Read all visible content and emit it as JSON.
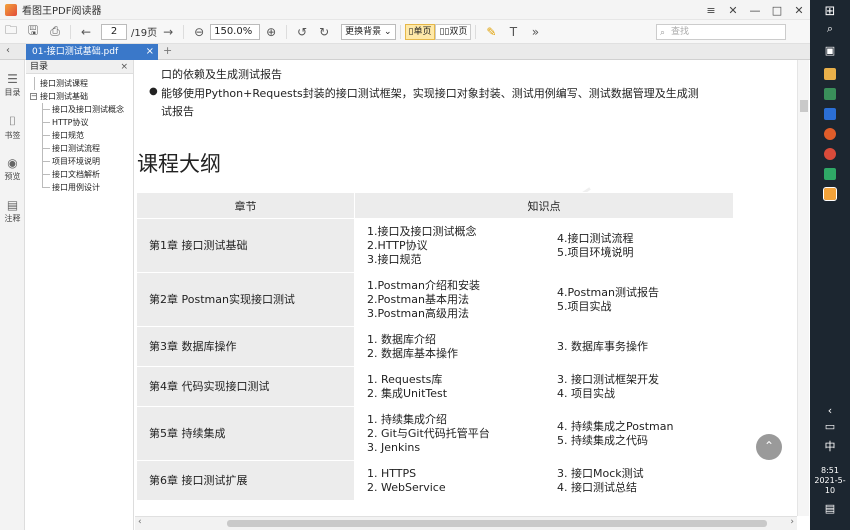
{
  "window": {
    "title": "看图王PDF阅读器",
    "controls": [
      "≡",
      "✕",
      "—",
      "□",
      "✕"
    ]
  },
  "toolbar": {
    "page_current": "2",
    "page_total": "/19页",
    "zoom": "150.0%",
    "background_label": "更换背景",
    "view_single": "单页",
    "view_double": "双页",
    "search_placeholder": "查找"
  },
  "tabbar": {
    "tab_label": "01-接口测试基础.pdf",
    "close": "×",
    "add": "+"
  },
  "leftbar": {
    "items": [
      {
        "label": "目录",
        "icon": "toc-icon"
      },
      {
        "label": "书签",
        "icon": "bookmark-icon"
      },
      {
        "label": "预览",
        "icon": "preview-icon"
      },
      {
        "label": "注释",
        "icon": "comment-icon"
      }
    ]
  },
  "outline": {
    "title": "目录",
    "close": "×",
    "root_items": [
      "接口测试课程",
      "接口测试基础"
    ],
    "children": [
      "接口及接口测试概念",
      "HTTP协议",
      "接口规范",
      "接口测试流程",
      "项目环境说明",
      "接口文档解析",
      "接口用例设计"
    ]
  },
  "document": {
    "bullet1_line1": "口的依赖及生成测试报告",
    "bullet2_line1": "能够使用Python+Requests封装的接口测试框架，实现接口对象封装、测试用例编写、测试数据管理及生成测",
    "bullet2_line2": "试报告",
    "section_title": "课程大纲",
    "table": {
      "header_chapter": "章节",
      "header_points": "知识点",
      "rows": [
        {
          "chapter": "第1章 接口测试基础",
          "left": [
            "1.接口及接口测试概念",
            "2.HTTP协议",
            "3.接口规范"
          ],
          "right": [
            "4.接口测试流程",
            "5.项目环境说明"
          ]
        },
        {
          "chapter": "第2章 Postman实现接口测试",
          "left": [
            "1.Postman介绍和安装",
            "2.Postman基本用法",
            "3.Postman高级用法"
          ],
          "right": [
            "4.Postman测试报告",
            "5.项目实战"
          ]
        },
        {
          "chapter": "第3章 数据库操作",
          "left": [
            "1. 数据库介绍",
            "2. 数据库基本操作"
          ],
          "right": [
            "3. 数据库事务操作"
          ]
        },
        {
          "chapter": "第4章 代码实现接口测试",
          "left": [
            "1. Requests库",
            "2. 集成UnitTest"
          ],
          "right": [
            "3. 接口测试框架开发",
            "4. 项目实战"
          ]
        },
        {
          "chapter": "第5章 持续集成",
          "left": [
            "1. 持续集成介绍",
            "2. Git与Git代码托管平台",
            "3. Jenkins"
          ],
          "right": [
            "4. 持续集成之Postman",
            "5. 持续集成之代码"
          ]
        },
        {
          "chapter": "第6章 接口测试扩展",
          "left": [
            "1. HTTPS",
            "2. WebService"
          ],
          "right": [
            "3. 接口Mock测试",
            "4. 接口测试总结"
          ]
        }
      ]
    }
  },
  "taskbar": {
    "time": "8:51",
    "date": "2021-5-10",
    "ime": "中"
  }
}
